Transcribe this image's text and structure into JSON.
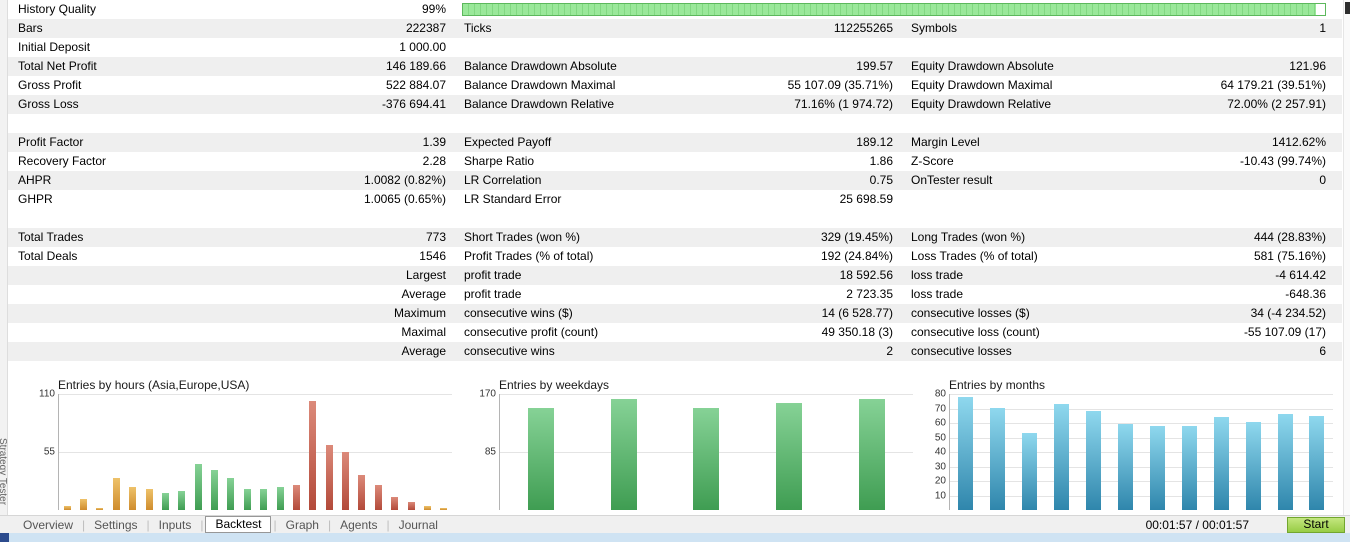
{
  "panel": {
    "vertical_label": "Strategy Tester"
  },
  "stats": {
    "history_quality_percent": 99,
    "rows": [
      {
        "type": "progress",
        "c1l": "History Quality",
        "c1v": "99%",
        "shaded": false
      },
      {
        "c1l": "Bars",
        "c1v": "222387",
        "c2l": "Ticks",
        "c2v": "112255265",
        "c3l": "Symbols",
        "c3v": "1",
        "shaded": true
      },
      {
        "c1l": "Initial Deposit",
        "c1v": "1 000.00",
        "shaded": false
      },
      {
        "c1l": "Total Net Profit",
        "c1v": "146 189.66",
        "c2l": "Balance Drawdown Absolute",
        "c2v": "199.57",
        "c3l": "Equity Drawdown Absolute",
        "c3v": "121.96",
        "shaded": true
      },
      {
        "c1l": "Gross Profit",
        "c1v": "522 884.07",
        "c2l": "Balance Drawdown Maximal",
        "c2v": "55 107.09 (35.71%)",
        "c3l": "Equity Drawdown Maximal",
        "c3v": "64 179.21 (39.51%)",
        "shaded": false
      },
      {
        "c1l": "Gross Loss",
        "c1v": "-376 694.41",
        "c2l": "Balance Drawdown Relative",
        "c2v": "71.16% (1 974.72)",
        "c3l": "Equity Drawdown Relative",
        "c3v": "72.00% (2 257.91)",
        "shaded": true
      },
      {
        "type": "spacer"
      },
      {
        "c1l": "Profit Factor",
        "c1v": "1.39",
        "c2l": "Expected Payoff",
        "c2v": "189.12",
        "c3l": "Margin Level",
        "c3v": "1412.62%",
        "shaded": true
      },
      {
        "c1l": "Recovery Factor",
        "c1v": "2.28",
        "c2l": "Sharpe Ratio",
        "c2v": "1.86",
        "c3l": "Z-Score",
        "c3v": "-10.43 (99.74%)",
        "shaded": false
      },
      {
        "c1l": "AHPR",
        "c1v": "1.0082 (0.82%)",
        "c2l": "LR Correlation",
        "c2v": "0.75",
        "c3l": "OnTester result",
        "c3v": "0",
        "shaded": true
      },
      {
        "c1l": "GHPR",
        "c1v": "1.0065 (0.65%)",
        "c2l": "LR Standard Error",
        "c2v": "25 698.59",
        "shaded": false
      },
      {
        "type": "spacer"
      },
      {
        "c1l": "Total Trades",
        "c1v": "773",
        "c2l": "Short Trades (won %)",
        "c2v": "329 (19.45%)",
        "c3l": "Long Trades (won %)",
        "c3v": "444 (28.83%)",
        "shaded": true
      },
      {
        "c1l": "Total Deals",
        "c1v": "1546",
        "c2l": "Profit Trades (% of total)",
        "c2v": "192 (24.84%)",
        "c3l": "Loss Trades (% of total)",
        "c3v": "581 (75.16%)",
        "shaded": false
      },
      {
        "c1v": "Largest",
        "c2l": "profit trade",
        "c2v": "18 592.56",
        "c3l": "loss trade",
        "c3v": "-4 614.42",
        "shaded": true
      },
      {
        "c1v": "Average",
        "c2l": "profit trade",
        "c2v": "2 723.35",
        "c3l": "loss trade",
        "c3v": "-648.36",
        "shaded": false
      },
      {
        "c1v": "Maximum",
        "c2l": "consecutive wins ($)",
        "c2v": "14 (6 528.77)",
        "c3l": "consecutive losses ($)",
        "c3v": "34 (-4 234.52)",
        "shaded": true
      },
      {
        "c1v": "Maximal",
        "c2l": "consecutive profit (count)",
        "c2v": "49 350.18 (3)",
        "c3l": "consecutive loss (count)",
        "c3v": "-55 107.09 (17)",
        "shaded": false
      },
      {
        "c1v": "Average",
        "c2l": "consecutive wins",
        "c2v": "2",
        "c3l": "consecutive losses",
        "c3v": "6",
        "shaded": true
      }
    ]
  },
  "chart_data": [
    {
      "type": "bar",
      "title": "Entries by hours (Asia,Europe,USA)",
      "ylim": [
        0,
        110
      ],
      "yticks": [
        110,
        55
      ],
      "values": [
        4,
        10,
        2,
        30,
        22,
        20,
        16,
        18,
        44,
        38,
        30,
        20,
        20,
        22,
        24,
        103,
        62,
        55,
        33,
        24,
        12,
        8,
        4,
        2
      ],
      "bar_colors": [
        "orange",
        "orange",
        "orange",
        "orange",
        "orange",
        "orange",
        "green",
        "green",
        "green",
        "green",
        "green",
        "green",
        "green",
        "green",
        "red",
        "red",
        "red",
        "red",
        "red",
        "red",
        "red",
        "red",
        "orange",
        "orange"
      ],
      "legend_position": "none",
      "grid": true
    },
    {
      "type": "bar",
      "title": "Entries by weekdays",
      "ylim": [
        0,
        170
      ],
      "yticks": [
        170,
        85
      ],
      "values": [
        150,
        163,
        150,
        157,
        162
      ],
      "bar_colors": [
        "green",
        "green",
        "green",
        "green",
        "green"
      ],
      "legend_position": "none",
      "grid": true
    },
    {
      "type": "bar",
      "title": "Entries by months",
      "ylim": [
        0,
        80
      ],
      "yticks": [
        80,
        70,
        60,
        50,
        40,
        30,
        20,
        10
      ],
      "values": [
        78,
        70,
        53,
        73,
        68,
        59,
        58,
        58,
        64,
        61,
        66,
        65
      ],
      "bar_colors": [
        "blue",
        "blue",
        "blue",
        "blue",
        "blue",
        "blue",
        "blue",
        "blue",
        "blue",
        "blue",
        "blue",
        "blue"
      ],
      "legend_position": "none",
      "grid": true
    }
  ],
  "palette": {
    "orange": "#cf8c2d",
    "green": "#3f9d52",
    "red": "#b34a3a",
    "blue": "#2f86ac",
    "quality_bar": "#8ee08e",
    "start_button": "#97cc45"
  },
  "tabs": {
    "items": [
      {
        "label": "Overview",
        "active": false
      },
      {
        "label": "Settings",
        "active": false
      },
      {
        "label": "Inputs",
        "active": false
      },
      {
        "label": "Backtest",
        "active": true
      },
      {
        "label": "Graph",
        "active": false
      },
      {
        "label": "Agents",
        "active": false
      },
      {
        "label": "Journal",
        "active": false
      }
    ]
  },
  "status": {
    "time": "00:01:57 / 00:01:57",
    "start_label": "Start"
  }
}
